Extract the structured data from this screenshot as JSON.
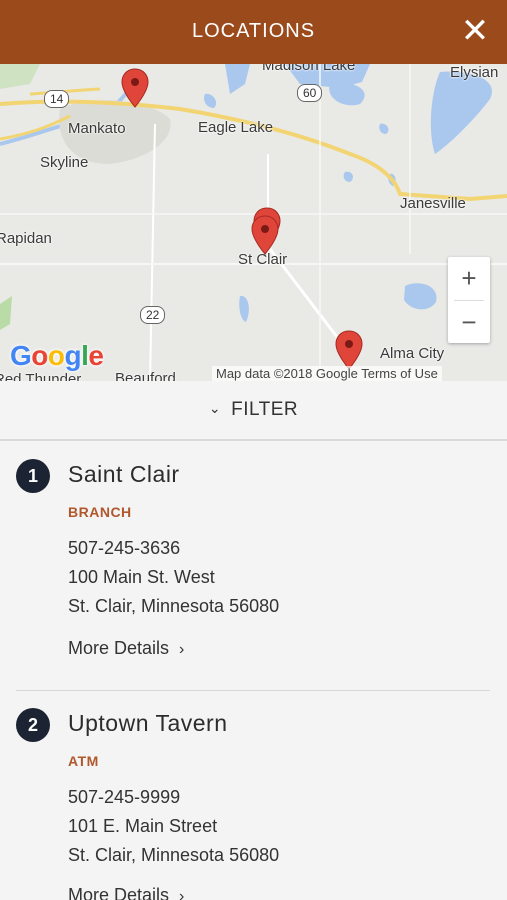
{
  "header": {
    "title": "LOCATIONS",
    "close_icon": "close-icon"
  },
  "map": {
    "labels": {
      "mankato": "Mankato",
      "eagle_lake": "Eagle Lake",
      "skyline": "Skyline",
      "janesville": "Janesville",
      "rapidan": "Rapidan",
      "st_clair": "St Clair",
      "alma_city": "Alma City",
      "elysian": "Elysian",
      "madison_lake": "Madison Lake",
      "beauford": "Beauford",
      "red_thunder": "Red Thunder"
    },
    "routes": {
      "r14": "14",
      "r60": "60",
      "r22": "22"
    },
    "zoom_in": "+",
    "zoom_out": "−",
    "google_logo": "Google",
    "attribution": "Map data ©2018 Google   Terms of Use"
  },
  "filter": {
    "label": "FILTER"
  },
  "locations": [
    {
      "number": "1",
      "name": "Saint Clair",
      "type": "BRANCH",
      "phone": "507-245-3636",
      "address1": "100 Main St. West",
      "address2": "St. Clair, Minnesota 56080",
      "more": "More Details"
    },
    {
      "number": "2",
      "name": "Uptown Tavern",
      "type": "ATM",
      "phone": "507-245-9999",
      "address1": "101 E. Main Street",
      "address2": "St. Clair, Minnesota 56080",
      "more": "More Details"
    }
  ],
  "colors": {
    "header": "#9b4a1c",
    "accent": "#b1572c",
    "badge": "#1c2433",
    "pin": "#e0453a"
  }
}
